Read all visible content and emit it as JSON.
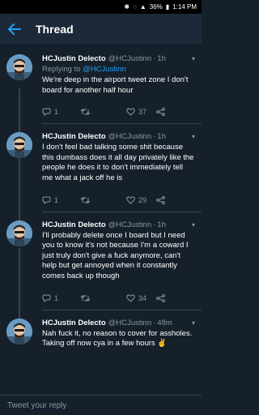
{
  "status_bar": {
    "battery": "36%",
    "time": "1:14 PM"
  },
  "app_bar": {
    "title": "Thread"
  },
  "tweets": [
    {
      "author": "HCJustin Delecto",
      "handle": "@HCJustinn",
      "time": "1h",
      "reply_to_label": "Replying to",
      "reply_to_mention": "@HCJustinn",
      "text": "We're deep in the airport tweet zone I don't board for another half hour",
      "reply_count": "1",
      "retweet_count": "",
      "like_count": "37"
    },
    {
      "author": "HCJustin Delecto",
      "handle": "@HCJustinn",
      "time": "1h",
      "text": "I don't feel bad talking some shit because this dumbass does it all day privately like the people he does it to don't immediately tell me what a jack off he is",
      "reply_count": "1",
      "retweet_count": "",
      "like_count": "29"
    },
    {
      "author": "HCJustin Delecto",
      "handle": "@HCJustinn",
      "time": "1h",
      "text": "I'll probably delete once I board but I need you to know it's not because I'm a coward I just truly don't give a fuck anymore, can't help but get annoyed when it constantly comes back up though",
      "reply_count": "1",
      "retweet_count": "",
      "like_count": "34"
    },
    {
      "author": "HCJustin Delecto",
      "handle": "@HCJustinn",
      "time": "48m",
      "text": "Nah fuck it, no reason to cover for assholes. Taking off now cya in a few hours ✌"
    }
  ],
  "compose": {
    "placeholder": "Tweet your reply"
  },
  "colors": {
    "background": "#15202b",
    "accent": "#1da1f2",
    "muted": "#8899a6",
    "divider": "#38444d"
  }
}
